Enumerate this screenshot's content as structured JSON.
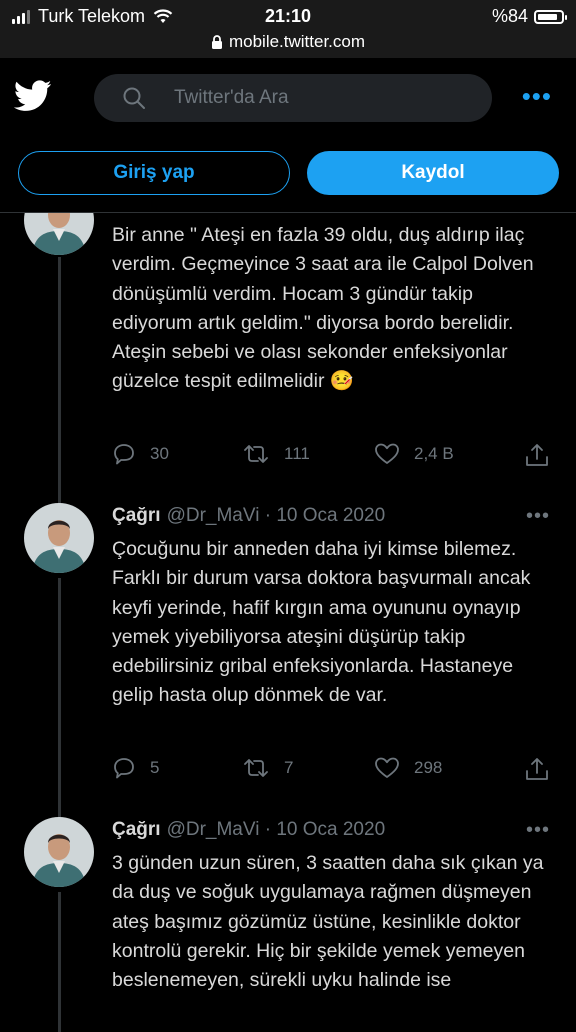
{
  "status_bar": {
    "carrier": "Turk Telekom",
    "time": "21:10",
    "battery": "%84",
    "url": "mobile.twitter.com"
  },
  "header": {
    "search_placeholder": "Twitter'da Ara",
    "more_label": "•••"
  },
  "auth": {
    "login_label": "Giriş yap",
    "signup_label": "Kaydol"
  },
  "tweets": [
    {
      "text": "Bir anne \" Ateşi en fazla 39 oldu, duş aldırıp ilaç verdim. Geçmeyince 3 saat ara ile Calpol Dolven dönüşümlü verdim. Hocam 3 gündür takip ediyorum artık geldim.\" diyorsa bordo berelidir. Ateşin sebebi ve olası sekonder enfeksiyonlar güzelce tespit edilmelidir 🤒",
      "replies": "30",
      "retweets": "111",
      "likes": "2,4 B"
    },
    {
      "name": "Çağrı",
      "handle": "@Dr_MaVi",
      "separator": "·",
      "date": "10 Oca 2020",
      "text": "Çocuğunu bir anneden daha iyi kimse bilemez. Farklı bir durum varsa doktora başvurmalı ancak keyfi yerinde, hafif kırgın ama oyununu oynayıp yemek yiyebiliyorsa ateşini düşürüp takip edebilirsiniz gribal enfeksiyonlarda. Hastaneye gelip hasta olup dönmek de var.",
      "replies": "5",
      "retweets": "7",
      "likes": "298"
    },
    {
      "name": "Çağrı",
      "handle": "@Dr_MaVi",
      "separator": "·",
      "date": "10 Oca 2020",
      "text": "3 günden uzun süren, 3 saatten daha sık çıkan ya da duş ve soğuk uygulamaya rağmen düşmeyen ateş  başımız gözümüz üstüne, kesinlikle doktor kontrolü gerekir. Hiç bir şekilde yemek yemeyen beslenemeyen, sürekli uyku halinde ise"
    }
  ],
  "colors": {
    "accent": "#1da1f2",
    "background": "#000000",
    "text": "#d9d9d9",
    "muted": "#6e767d"
  },
  "icons": [
    "twitter-bird-icon",
    "search-icon",
    "lock-icon",
    "wifi-icon",
    "reply-icon",
    "retweet-icon",
    "like-icon",
    "share-icon"
  ]
}
